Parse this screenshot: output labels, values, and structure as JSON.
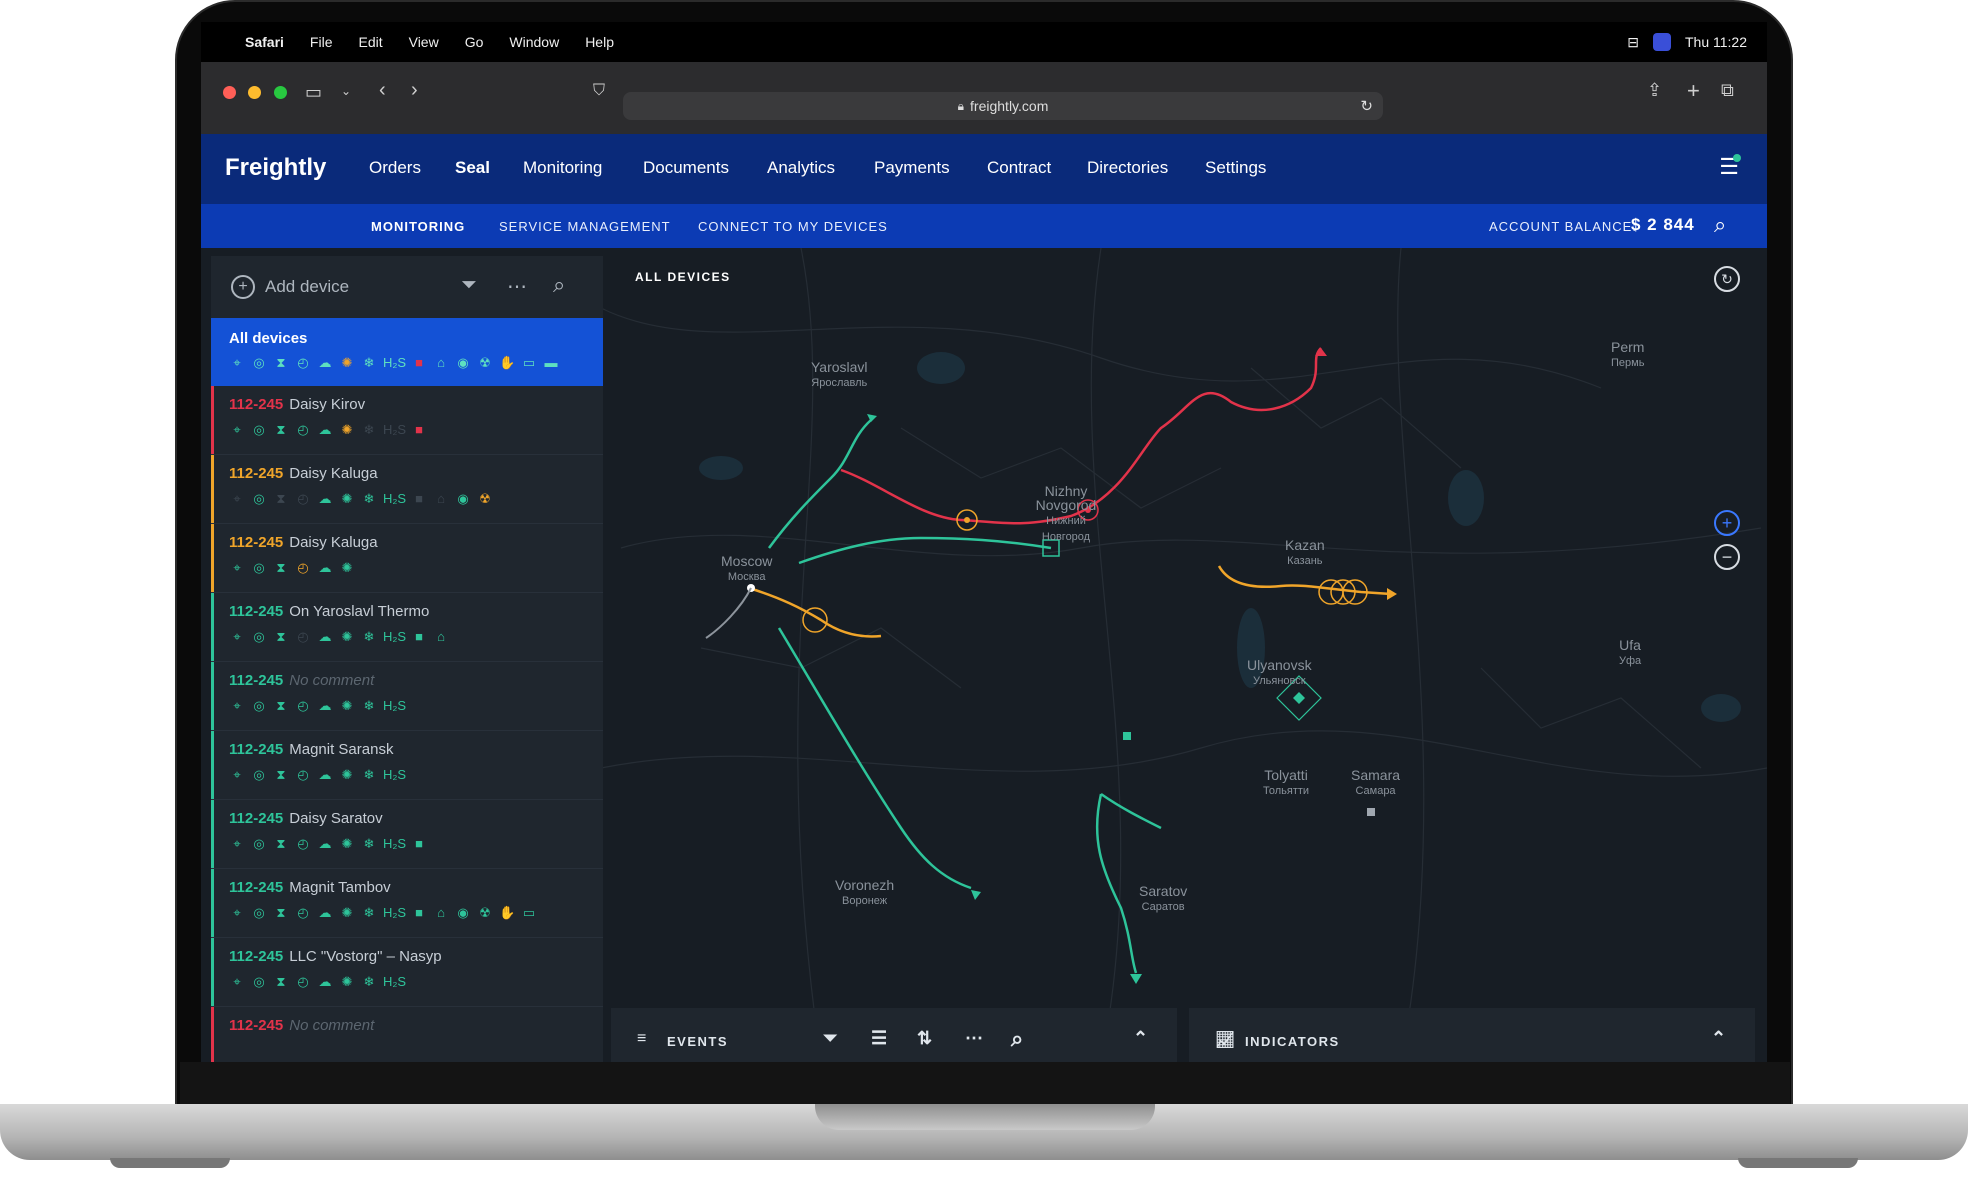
{
  "macos": {
    "app_name": "Safari",
    "menus": [
      "File",
      "Edit",
      "View",
      "Go",
      "Window",
      "Help"
    ],
    "clock": "Thu 11:22"
  },
  "browser": {
    "url": "freightly.com"
  },
  "app": {
    "logo": "Freightly",
    "main_nav": [
      "Orders",
      "Seal",
      "Monitoring",
      "Documents",
      "Analytics",
      "Payments",
      "Contract",
      "Directories",
      "Settings"
    ],
    "active_main": "Seal",
    "sub_nav": [
      "MONITORING",
      "SERVICE MANAGEMENT",
      "CONNECT TO MY DEVICES"
    ],
    "active_sub": "MONITORING",
    "balance_label": "ACCOUNT BALANCE:",
    "balance_value": "$ 2 844"
  },
  "sidebar": {
    "add_device": "Add device",
    "all_devices": "All devices",
    "devices": [
      {
        "code": "112-245",
        "name": "Daisy Kirov",
        "status": "red"
      },
      {
        "code": "112-245",
        "name": "Daisy Kaluga",
        "status": "orange"
      },
      {
        "code": "112-245",
        "name": "Daisy Kaluga",
        "status": "orange"
      },
      {
        "code": "112-245",
        "name": "On Yaroslavl Thermo",
        "status": "green"
      },
      {
        "code": "112-245",
        "name": "No comment",
        "status": "green"
      },
      {
        "code": "112-245",
        "name": "Magnit Saransk",
        "status": "green"
      },
      {
        "code": "112-245",
        "name": "Daisy Saratov",
        "status": "green"
      },
      {
        "code": "112-245",
        "name": "Magnit Tambov",
        "status": "green"
      },
      {
        "code": "112-245",
        "name": "LLC \"Vostorg\" – Nasyp",
        "status": "green"
      },
      {
        "code": "112-245",
        "name": "No comment",
        "status": "red"
      }
    ]
  },
  "map": {
    "title": "ALL DEVICES",
    "cities": [
      {
        "name": "Yaroslavl",
        "sub": "Ярославль"
      },
      {
        "name": "Moscow",
        "sub": "Москва"
      },
      {
        "name": "Nizhny Novgorod",
        "sub": "Нижний Новгород"
      },
      {
        "name": "Kazan",
        "sub": "Казань"
      },
      {
        "name": "Ulyanovsk",
        "sub": "Ульяновск"
      },
      {
        "name": "Tolyatti",
        "sub": "Тольятти"
      },
      {
        "name": "Samara",
        "sub": "Самара"
      },
      {
        "name": "Voronezh",
        "sub": "Воронеж"
      },
      {
        "name": "Saratov",
        "sub": "Саратов"
      },
      {
        "name": "Perm",
        "sub": "Пермь"
      },
      {
        "name": "Ufa",
        "sub": "Уфа"
      }
    ]
  },
  "panels": {
    "events": "EVENTS",
    "indicators": "INDICATORS"
  },
  "colors": {
    "nav_dark": "#0a2a7a",
    "nav_blue": "#0c3bb4",
    "red": "#e2334a",
    "orange": "#f0a52a",
    "green": "#2ec49a"
  }
}
